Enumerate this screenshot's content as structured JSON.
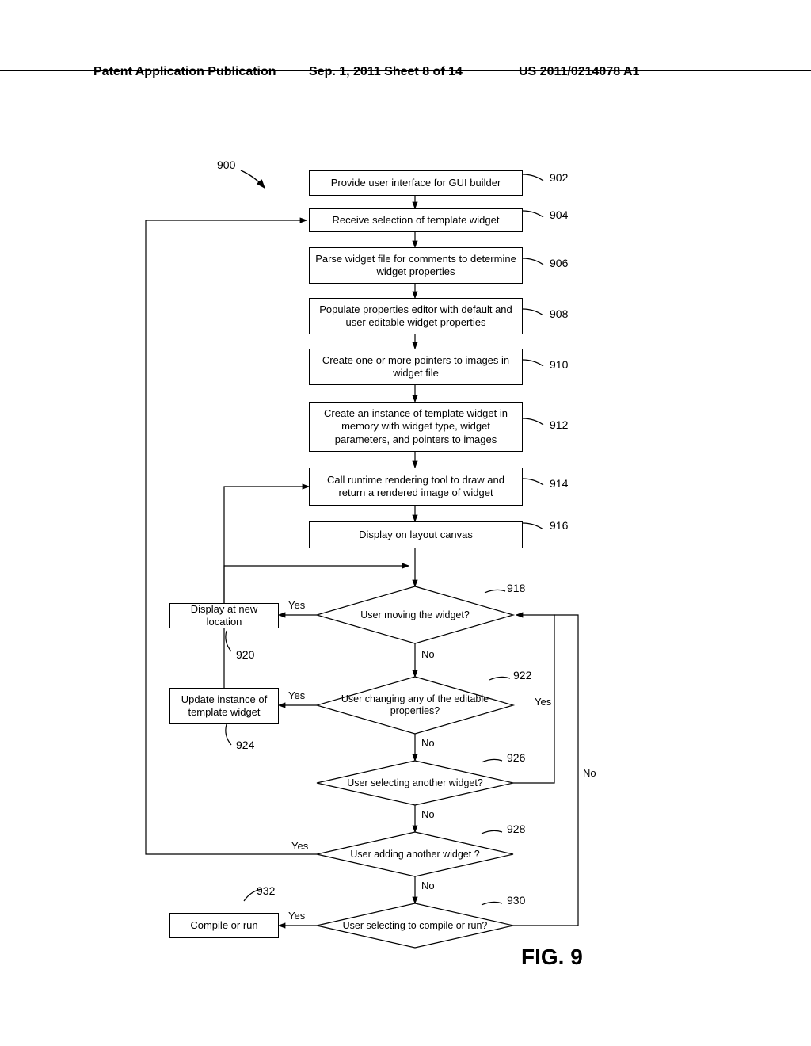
{
  "header": {
    "left": "Patent Application Publication",
    "center": "Sep. 1, 2011  Sheet 8 of 14",
    "pubnum": "US 2011/0214078 A1"
  },
  "figure_label": "FIG. 9",
  "chart_data": {
    "type": "flowchart",
    "title_ref": "900",
    "nodes": [
      {
        "id": "902",
        "type": "process",
        "text": "Provide user interface for GUI builder"
      },
      {
        "id": "904",
        "type": "process",
        "text": "Receive selection of template widget"
      },
      {
        "id": "906",
        "type": "process",
        "text": "Parse widget file for comments to determine widget properties"
      },
      {
        "id": "908",
        "type": "process",
        "text": "Populate properties editor with default and user editable widget properties"
      },
      {
        "id": "910",
        "type": "process",
        "text": "Create one or more pointers to images in widget file"
      },
      {
        "id": "912",
        "type": "process",
        "text": "Create an instance of template widget in memory with widget type, widget parameters, and pointers to images"
      },
      {
        "id": "914",
        "type": "process",
        "text": "Call runtime rendering tool to draw and return a rendered image of widget"
      },
      {
        "id": "916",
        "type": "process",
        "text": "Display on layout canvas"
      },
      {
        "id": "918",
        "type": "decision",
        "text": "User moving the widget?"
      },
      {
        "id": "920",
        "type": "process",
        "text": "Display at new location"
      },
      {
        "id": "922",
        "type": "decision",
        "text": "User changing any of the editable properties?"
      },
      {
        "id": "924",
        "type": "process",
        "text": "Update instance of template widget"
      },
      {
        "id": "926",
        "type": "decision",
        "text": "User selecting another widget?"
      },
      {
        "id": "928",
        "type": "decision",
        "text": "User adding another widget ?"
      },
      {
        "id": "930",
        "type": "decision",
        "text": "User selecting to compile or run?"
      },
      {
        "id": "932",
        "type": "process",
        "text": "Compile or run"
      }
    ],
    "edges": [
      {
        "from": "902",
        "to": "904"
      },
      {
        "from": "904",
        "to": "906"
      },
      {
        "from": "906",
        "to": "908"
      },
      {
        "from": "908",
        "to": "910"
      },
      {
        "from": "910",
        "to": "912"
      },
      {
        "from": "912",
        "to": "914"
      },
      {
        "from": "914",
        "to": "916"
      },
      {
        "from": "916",
        "to": "918"
      },
      {
        "from": "918",
        "to": "920",
        "label": "Yes"
      },
      {
        "from": "920",
        "to": "918",
        "note": "loop back above 918"
      },
      {
        "from": "918",
        "to": "922",
        "label": "No"
      },
      {
        "from": "922",
        "to": "924",
        "label": "Yes"
      },
      {
        "from": "924",
        "to": "914",
        "note": "loop back"
      },
      {
        "from": "922",
        "to": "926",
        "label": "No"
      },
      {
        "from": "926",
        "to": "918",
        "label": "Yes",
        "note": "right-side loop"
      },
      {
        "from": "926",
        "to": "928",
        "label": "No"
      },
      {
        "from": "928",
        "to": "904",
        "label": "Yes",
        "note": "left-side long loop"
      },
      {
        "from": "928",
        "to": "930",
        "label": "No"
      },
      {
        "from": "930",
        "to": "932",
        "label": "Yes"
      },
      {
        "from": "930",
        "to": "918",
        "label": "No",
        "note": "far-right loop"
      }
    ]
  },
  "boxes": {
    "b902": "Provide user interface for GUI builder",
    "b904": "Receive selection of template widget",
    "b906": "Parse widget file for comments to determine widget properties",
    "b908": "Populate properties editor with default and user editable widget properties",
    "b910": "Create one or more pointers to images in widget file",
    "b912": "Create an instance of template widget in memory with widget type, widget parameters, and pointers to images",
    "b914": "Call runtime rendering tool to draw and return a rendered image of widget",
    "b916": "Display on layout canvas",
    "b920": "Display at new location",
    "b924": "Update instance of template widget",
    "b932": "Compile or run"
  },
  "diamonds": {
    "d918": "User moving the widget?",
    "d922": "User changing any of the editable properties?",
    "d926": "User selecting another widget?",
    "d928": "User adding another widget ?",
    "d930": "User selecting to compile or run?"
  },
  "refs": {
    "r900": "900",
    "r902": "902",
    "r904": "904",
    "r906": "906",
    "r908": "908",
    "r910": "910",
    "r912": "912",
    "r914": "914",
    "r916": "916",
    "r918": "918",
    "r920": "920",
    "r922": "922",
    "r924": "924",
    "r926": "926",
    "r928": "928",
    "r930": "930",
    "r932": "932"
  },
  "labels": {
    "yes": "Yes",
    "no": "No"
  }
}
